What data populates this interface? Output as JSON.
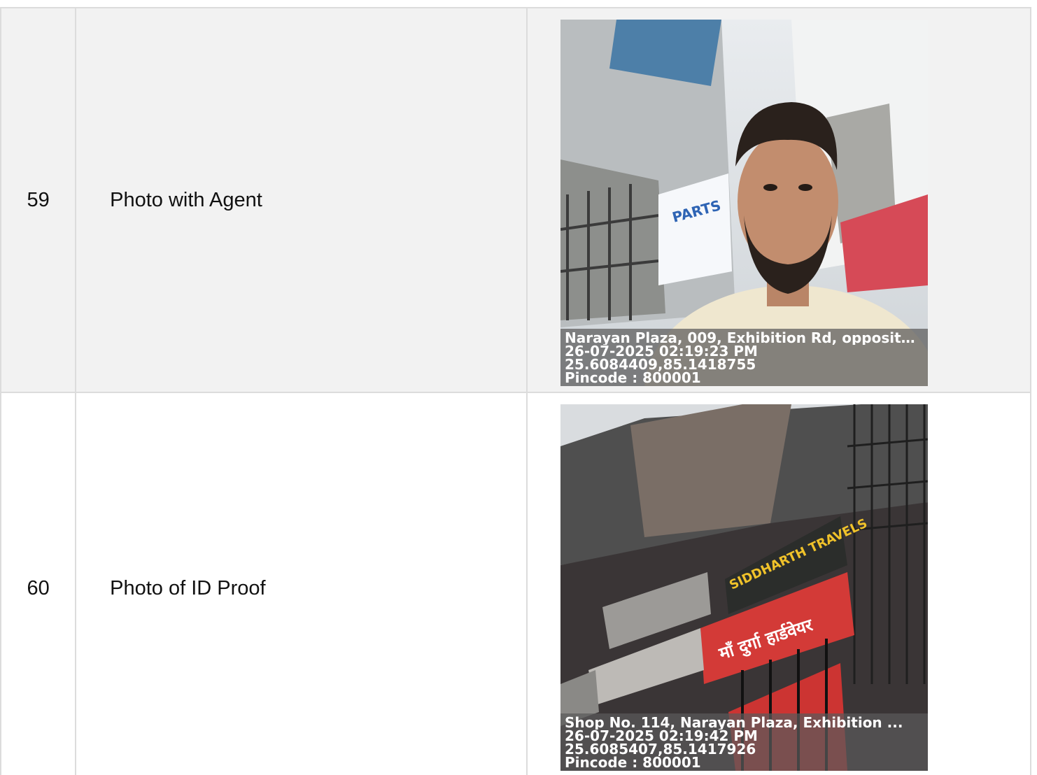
{
  "rows": [
    {
      "sno": "59",
      "label": "Photo with Agent",
      "photo": {
        "description_icon": "selfie-photo",
        "stamp_address": "Narayan Plaza, 009, Exhibition Rd, opposite ...",
        "stamp_datetime": "26-07-2025 02:19:23 PM",
        "stamp_coords": "25.6084409,85.1418755",
        "stamp_pincode": "Pincode : 800001",
        "sign_text": "PARTS"
      }
    },
    {
      "sno": "60",
      "label": "Photo of ID Proof",
      "photo": {
        "description_icon": "shopfront-photo",
        "stamp_address": "Shop No. 114, Narayan Plaza, Exhibition ...",
        "stamp_datetime": "26-07-2025 02:19:42 PM",
        "stamp_coords": "25.6085407,85.1417926",
        "stamp_pincode": "Pincode : 800001",
        "sign_text_1": "SIDDHARTH TRAVELS",
        "sign_text_2": "माँ दुर्गा हार्डवेयर"
      }
    }
  ],
  "colors": {
    "border": "#dcdcdc",
    "row_shaded": "#f2f2f2",
    "text": "#111111"
  }
}
